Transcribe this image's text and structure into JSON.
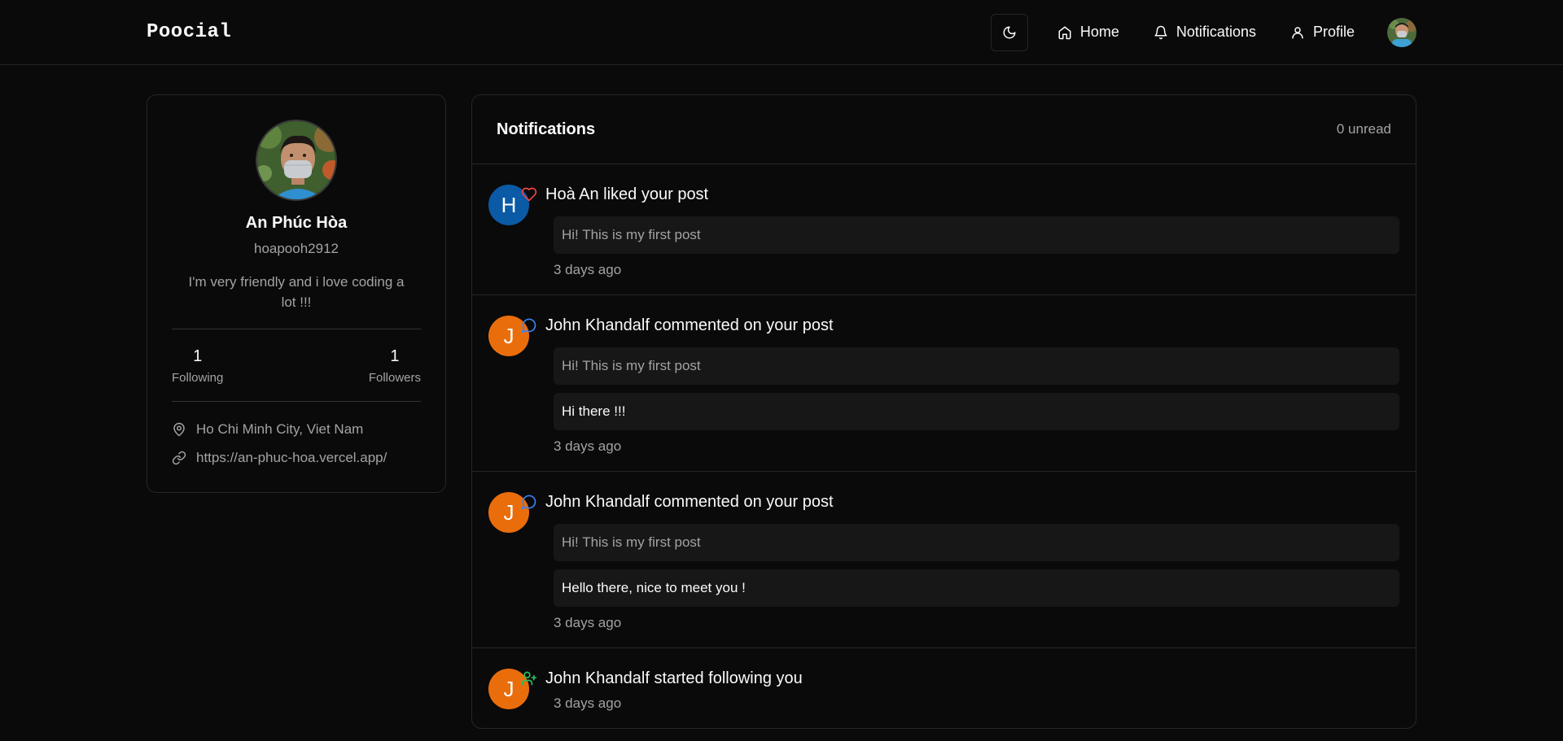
{
  "app": {
    "logo": "Poocial"
  },
  "nav": {
    "theme_icon": "moon-icon",
    "items": [
      {
        "label": "Home",
        "icon": "home-icon"
      },
      {
        "label": "Notifications",
        "icon": "bell-icon"
      },
      {
        "label": "Profile",
        "icon": "user-icon"
      }
    ]
  },
  "profile": {
    "name": "An Phúc Hòa",
    "username": "hoapooh2912",
    "bio": "I'm very friendly and i love coding a lot !!!",
    "following_count": "1",
    "following_label": "Following",
    "followers_count": "1",
    "followers_label": "Followers",
    "location": "Ho Chi Minh City, Viet Nam",
    "website": "https://an-phuc-hoa.vercel.app/"
  },
  "notifications": {
    "title": "Notifications",
    "unread": "0 unread",
    "items": [
      {
        "type": "like",
        "avatar_letter": "H",
        "avatar_color": "#0a5aa6",
        "text": "Hoà An liked your post",
        "post": "Hi! This is my first post",
        "time": "3 days ago"
      },
      {
        "type": "comment",
        "avatar_letter": "J",
        "avatar_color": "#ea6d0c",
        "text": "John Khandalf commented on your post",
        "post": "Hi! This is my first post",
        "comment": "Hi there !!!",
        "time": "3 days ago"
      },
      {
        "type": "comment",
        "avatar_letter": "J",
        "avatar_color": "#ea6d0c",
        "text": "John Khandalf commented on your post",
        "post": "Hi! This is my first post",
        "comment": "Hello there, nice to meet you !",
        "time": "3 days ago"
      },
      {
        "type": "follow",
        "avatar_letter": "J",
        "avatar_color": "#ea6d0c",
        "text": "John Khandalf started following you",
        "time": "3 days ago"
      }
    ]
  },
  "colors": {
    "like": "#ef4444",
    "comment": "#3b82f6",
    "follow": "#22c55e"
  }
}
